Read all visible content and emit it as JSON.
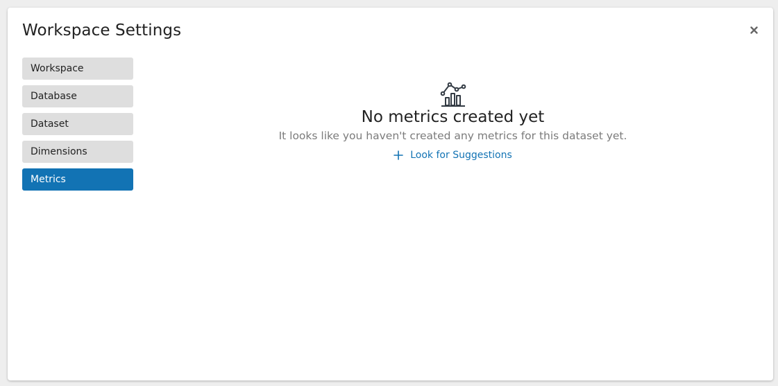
{
  "modal": {
    "title": "Workspace Settings",
    "close_icon": "close-icon"
  },
  "sidebar": {
    "items": [
      {
        "label": "Workspace",
        "active": false
      },
      {
        "label": "Database",
        "active": false
      },
      {
        "label": "Dataset",
        "active": false
      },
      {
        "label": "Dimensions",
        "active": false
      },
      {
        "label": "Metrics",
        "active": true
      }
    ]
  },
  "empty_state": {
    "icon": "chart-icon",
    "title": "No metrics created yet",
    "description": "It looks like you haven't created any metrics for this dataset yet.",
    "action_label": "Look for Suggestions",
    "action_icon": "plus-icon"
  },
  "colors": {
    "accent": "#1273b4",
    "nav_bg": "#dedede",
    "text": "#222222",
    "muted": "#7b7b7b"
  }
}
